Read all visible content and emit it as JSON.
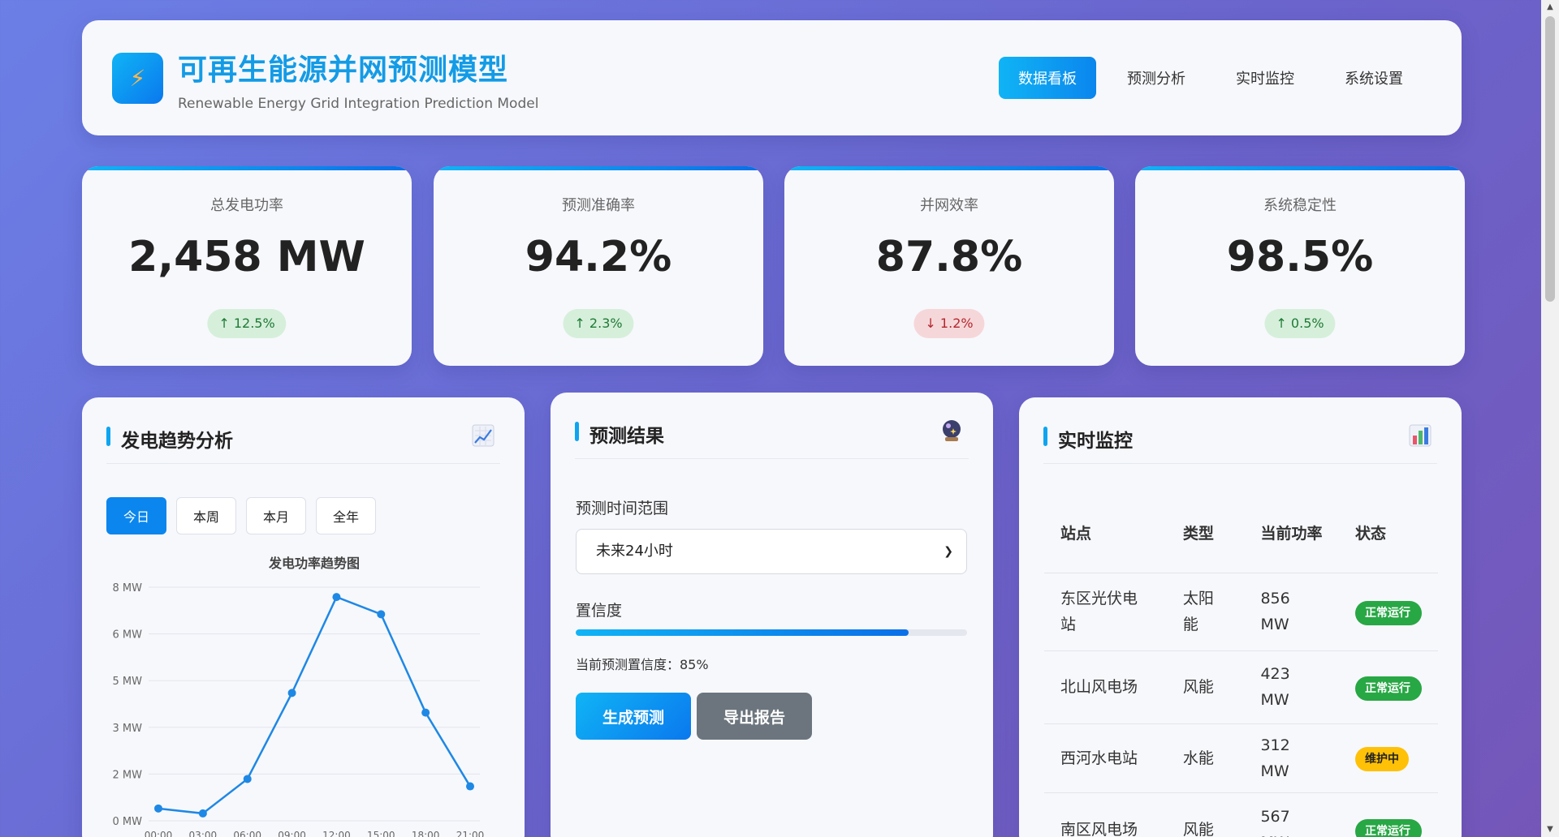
{
  "header": {
    "title": "可再生能源并网预测模型",
    "subtitle": "Renewable Energy Grid Integration Prediction Model",
    "logo_icon": "lightning-icon",
    "nav": [
      {
        "label": "数据看板",
        "active": true
      },
      {
        "label": "预测分析",
        "active": false
      },
      {
        "label": "实时监控",
        "active": false
      },
      {
        "label": "系统设置",
        "active": false
      }
    ]
  },
  "stats": [
    {
      "label": "总发电功率",
      "value": "2,458 MW",
      "change": "↑ 12.5%",
      "direction": "up"
    },
    {
      "label": "预测准确率",
      "value": "94.2%",
      "change": "↑ 2.3%",
      "direction": "up"
    },
    {
      "label": "并网效率",
      "value": "87.8%",
      "change": "↓ 1.2%",
      "direction": "down"
    },
    {
      "label": "系统稳定性",
      "value": "98.5%",
      "change": "↑ 0.5%",
      "direction": "up"
    }
  ],
  "trend": {
    "title": "发电趋势分析",
    "icon": "chart-increasing-icon",
    "tabs": [
      "今日",
      "本周",
      "本月",
      "全年"
    ],
    "active_tab": 0
  },
  "chart_data": {
    "type": "line",
    "title": "发电功率趋势图",
    "x": [
      "00:00",
      "03:00",
      "06:00",
      "09:00",
      "12:00",
      "15:00",
      "18:00",
      "21:00"
    ],
    "y_ticks": [
      "0 MW",
      "2 MW",
      "3 MW",
      "5 MW",
      "6 MW",
      "8 MW"
    ],
    "series": [
      {
        "values": [
          0.5,
          0.3,
          1.7,
          5.2,
          9.1,
          8.4,
          4.4,
          1.4
        ],
        "color": "#1e88e5"
      }
    ],
    "grid": true
  },
  "prediction": {
    "title": "预测结果",
    "icon": "crystal-ball-icon",
    "range_label": "预测时间范围",
    "range_value": "未来24小时",
    "confidence_label": "置信度",
    "confidence_fraction": 0.85,
    "confidence_text": "当前预测置信度：85%",
    "generate_label": "生成预测",
    "export_label": "导出报告"
  },
  "monitor": {
    "title": "实时监控",
    "icon": "bar-chart-icon",
    "columns": [
      "站点",
      "类型",
      "当前功率",
      "状态"
    ],
    "rows": [
      {
        "station": "东区光伏电站",
        "type": "太阳能",
        "power": "856 MW",
        "status": "正常运行",
        "status_kind": "ok"
      },
      {
        "station": "北山风电场",
        "type": "风能",
        "power": "423 MW",
        "status": "正常运行",
        "status_kind": "ok"
      },
      {
        "station": "西河水电站",
        "type": "水能",
        "power": "312 MW",
        "status": "维护中",
        "status_kind": "warn"
      },
      {
        "station": "南区风电场",
        "type": "风能",
        "power": "567 MW",
        "status": "正常运行",
        "status_kind": "ok"
      }
    ]
  },
  "colors": {
    "accent": "#0ea5f0",
    "ok": "#28a745",
    "warn": "#ffc107",
    "up_bg": "#d6efdb",
    "down_bg": "#f6d7d9"
  }
}
